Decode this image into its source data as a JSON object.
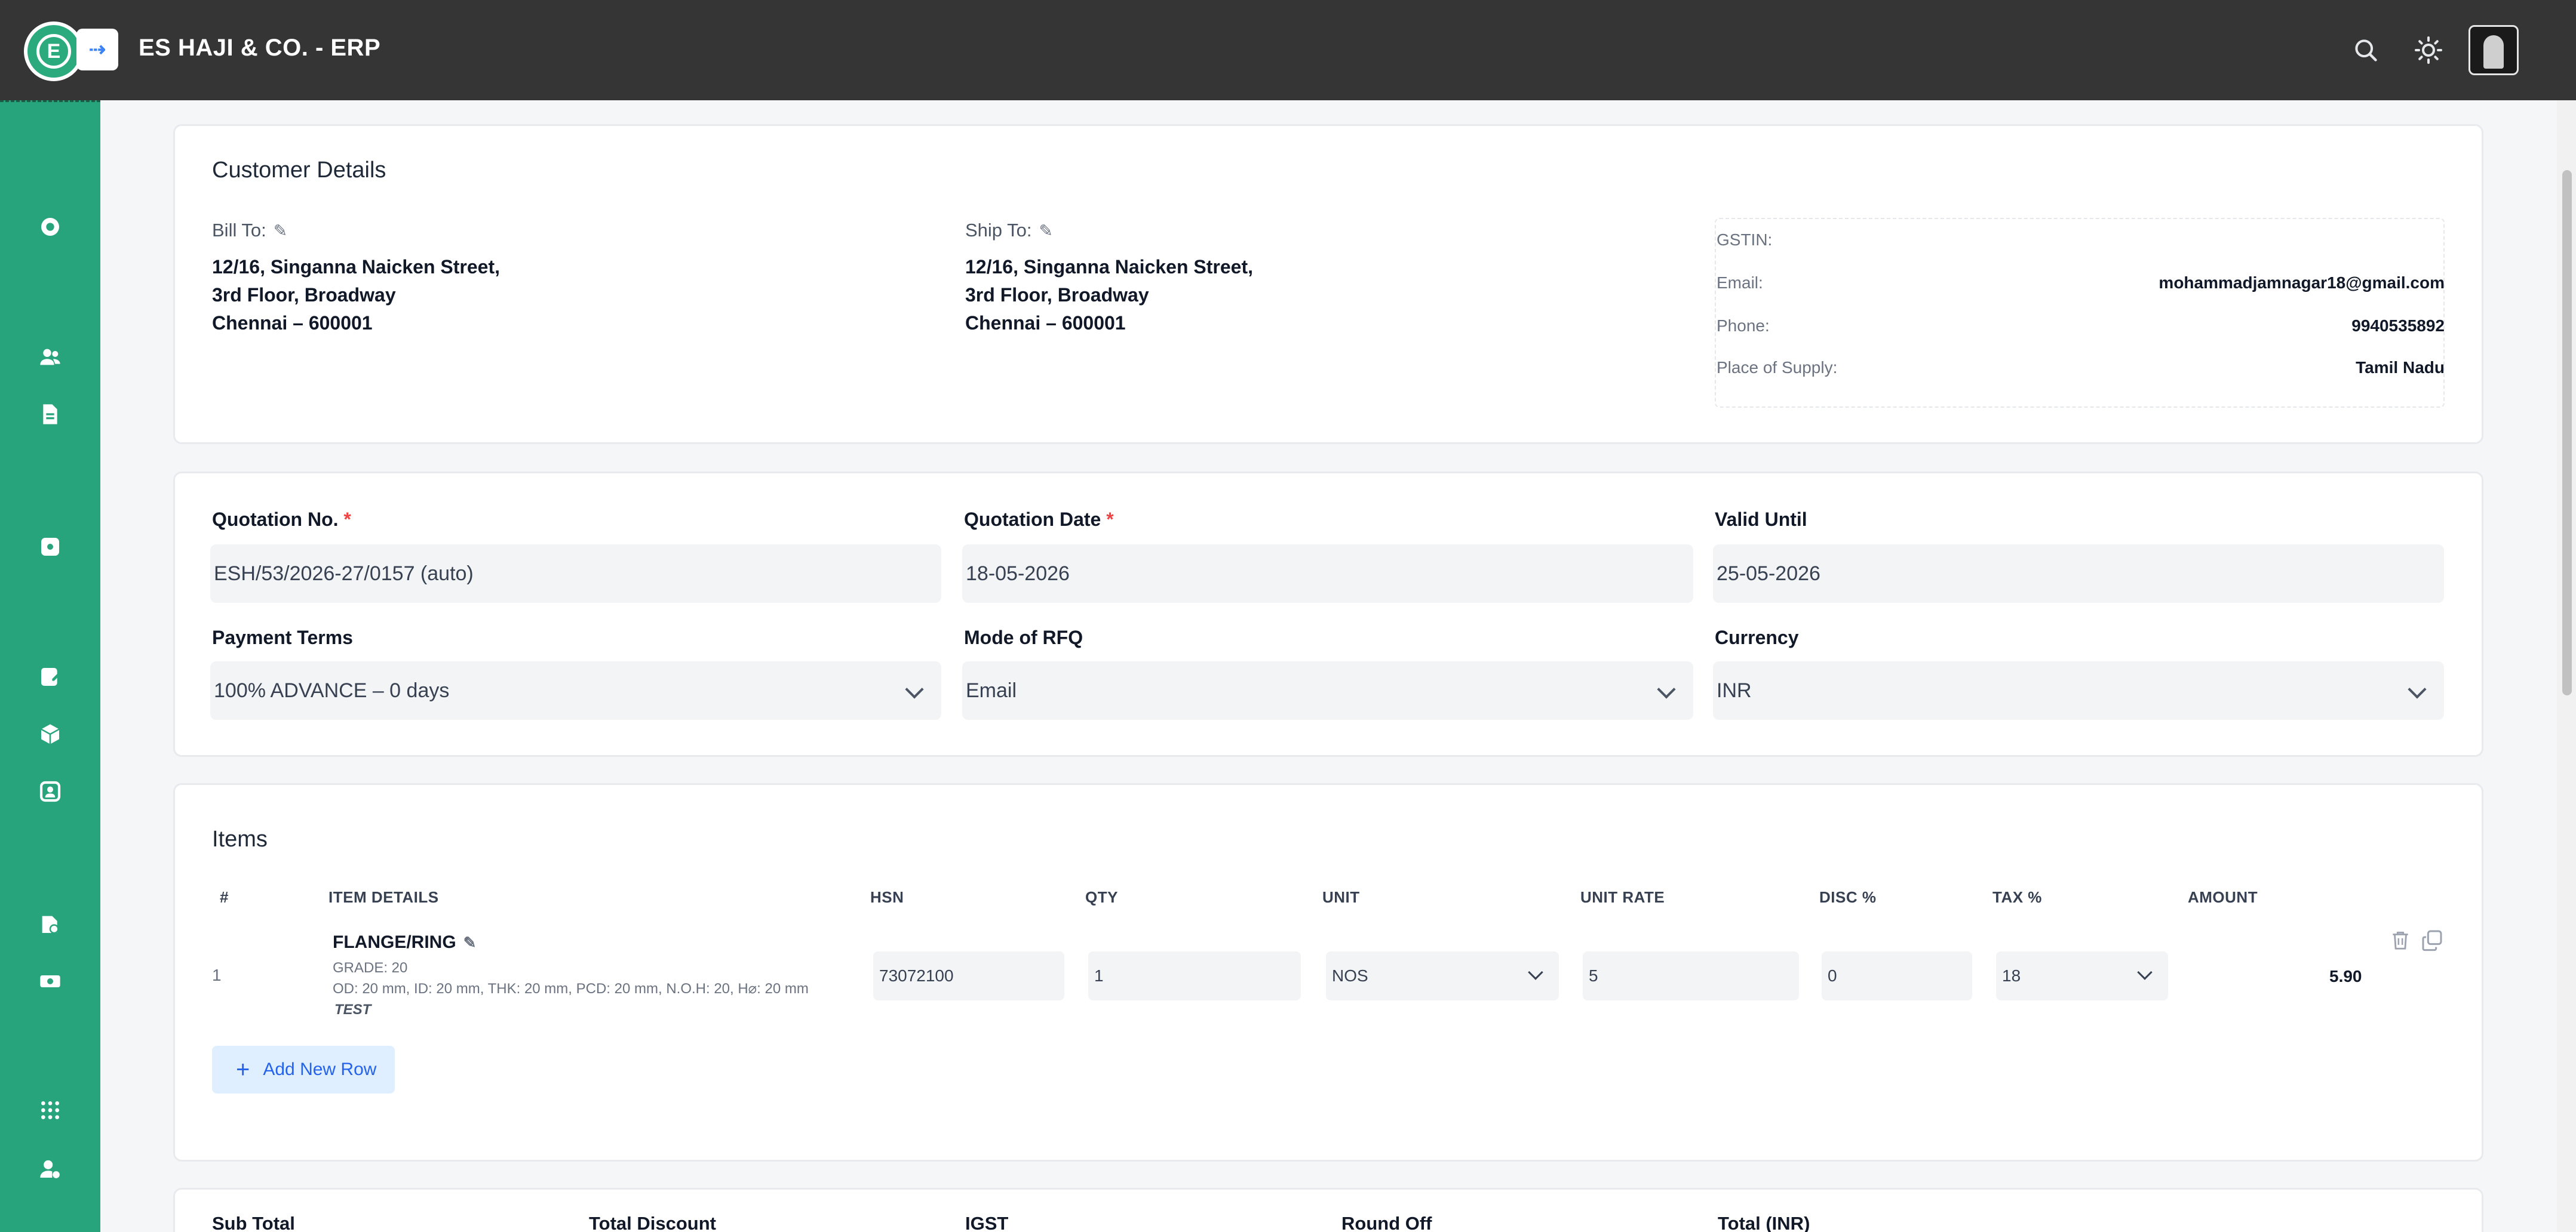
{
  "header": {
    "logo_letter": "E",
    "title": "ES HAJI & CO. - ERP",
    "collapse_icon": "sidebar-toggle-icon",
    "icons": [
      "search-icon",
      "sun-icon",
      "avatar"
    ]
  },
  "sidebar": {
    "icons": [
      "dashboard-icon",
      "users-icon",
      "document-icon",
      "package-icon",
      "edit-document-icon",
      "box-icon",
      "contact-card-icon",
      "files-icon",
      "cash-icon",
      "network-icon",
      "user-settings-icon"
    ]
  },
  "customer": {
    "title": "Customer Details",
    "bill_to_label": "Bill To:",
    "ship_to_label": "Ship To:",
    "bill_address": [
      "12/16, Singanna Naicken Street,",
      "3rd Floor, Broadway",
      "Chennai – 600001"
    ],
    "ship_address": [
      "12/16, Singanna Naicken Street,",
      "3rd Floor, Broadway",
      "Chennai – 600001"
    ],
    "gstin_label": "GSTIN:",
    "gstin_value": "",
    "email_label": "Email:",
    "email_value": "mohammadjamnagar18@gmail.com",
    "phone_label": "Phone:",
    "phone_value": "9940535892",
    "place_label": "Place of Supply:",
    "place_value": "Tamil Nadu"
  },
  "quotation": {
    "no_label": "Quotation No.",
    "no_value": "ESH/53/2026-27/0157 (auto)",
    "date_label": "Quotation Date",
    "date_value": "18-05-2026",
    "valid_label": "Valid Until",
    "valid_value": "25-05-2026",
    "payment_label": "Payment Terms",
    "payment_value": "100% ADVANCE – 0 days",
    "mode_label": "Mode of RFQ",
    "mode_value": "Email",
    "currency_label": "Currency",
    "currency_value": "INR",
    "required_mark": "*"
  },
  "items": {
    "title": "Items",
    "headers": {
      "num": "#",
      "details": "ITEM DETAILS",
      "hsn": "HSN",
      "qty": "QTY",
      "unit": "UNIT",
      "rate": "UNIT RATE",
      "disc": "DISC %",
      "tax": "TAX %",
      "amount": "AMOUNT"
    },
    "rows": [
      {
        "num": "1",
        "name": "FLANGE/RING",
        "grade": "GRADE: 20",
        "specs": "OD: 20 mm, ID: 20 mm, THK: 20 mm, PCD: 20 mm, N.O.H: 20, H⌀: 20 mm",
        "note": "TEST",
        "hsn": "73072100",
        "qty": "1",
        "unit": "NOS",
        "rate": "5",
        "disc": "0",
        "tax": "18",
        "amount": "5.90"
      }
    ],
    "add_row_label": "Add New Row"
  },
  "summary": {
    "sub_total": "Sub Total",
    "total_discount": "Total Discount",
    "igst": "IGST",
    "round_off": "Round Off",
    "total": "Total (INR)"
  }
}
